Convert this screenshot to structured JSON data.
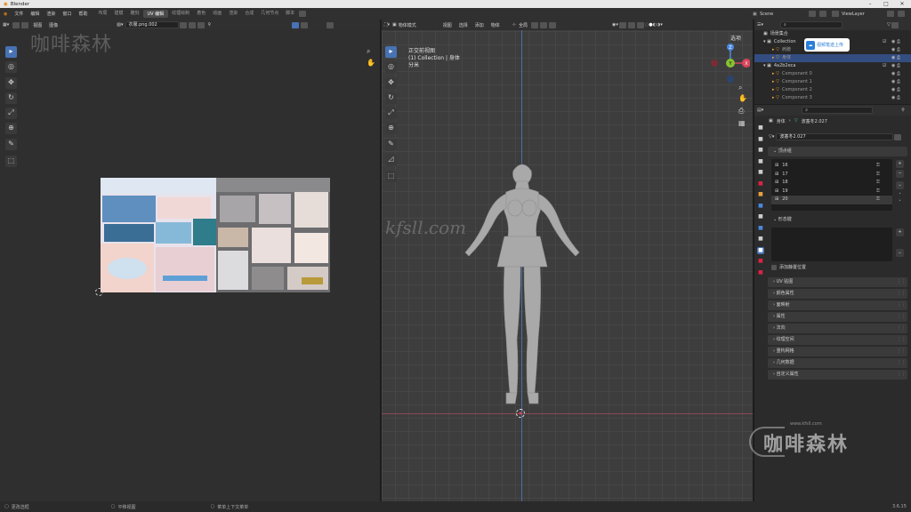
{
  "app_title": "Blender",
  "menus": [
    "文件",
    "编辑",
    "渲染",
    "窗口",
    "帮助"
  ],
  "workspaces": [
    "布局",
    "建模",
    "雕刻",
    "UV 编辑",
    "纹理绘制",
    "着色",
    "动画",
    "渲染",
    "合成",
    "几何节点",
    "脚本"
  ],
  "active_workspace": "UV 编辑",
  "scene_name": "Scene",
  "view_layer": "ViewLayer",
  "uv_editor": {
    "menus": [
      "视图",
      "图像"
    ],
    "image_name": "衣服.png.002",
    "watermark": "咖啡森林"
  },
  "viewport": {
    "mode": "物体模式",
    "menus": [
      "视图",
      "选择",
      "添加",
      "物体"
    ],
    "orientation": "全局",
    "overlay_title": "正交前视图",
    "overlay_collection": "(1) Collection | 身体",
    "overlay_units": "分米",
    "options_label": "选项",
    "watermark": "kfsll.com",
    "gizmo_axes": [
      "X",
      "Y",
      "Z"
    ]
  },
  "outliner": {
    "root": "场景集合",
    "items": [
      {
        "label": "Collection",
        "level": 1
      },
      {
        "label": "肩膀",
        "level": 2
      },
      {
        "label": "身体",
        "level": 2
      },
      {
        "label": "4a2b2eca",
        "level": 1
      },
      {
        "label": "Component 0",
        "level": 2
      },
      {
        "label": "Component 1",
        "level": 2
      },
      {
        "label": "Component 2",
        "level": 2
      },
      {
        "label": "Component 3",
        "level": 2
      }
    ],
    "popup": "视频笔迹上传"
  },
  "properties": {
    "breadcrumb_object": "身体",
    "breadcrumb_mesh": "波塞冬2.027",
    "mesh_name": "波塞冬2.027",
    "vertex_groups_title": "顶点组",
    "vertex_groups": [
      "16",
      "17",
      "18",
      "19",
      "20"
    ],
    "shape_keys_title": "形态键",
    "relative_label": "添加静置位置",
    "panels": [
      "UV 贴图",
      "颜色属性",
      "面映射",
      "属性",
      "法向",
      "纹理空间",
      "重构网格",
      "几何数据",
      "自定义属性"
    ]
  },
  "status_bar": {
    "items": [
      "更改选框",
      "平移视图",
      "菜单上下文菜单"
    ],
    "version": "3.6.15"
  },
  "brand_watermark": {
    "url": "www.kfsll.com",
    "name": "咖啡森林"
  },
  "colors": {
    "accent": "#4772b3",
    "active_highlight": "#334d80",
    "vgroup_bg": "#1e1e1e"
  }
}
